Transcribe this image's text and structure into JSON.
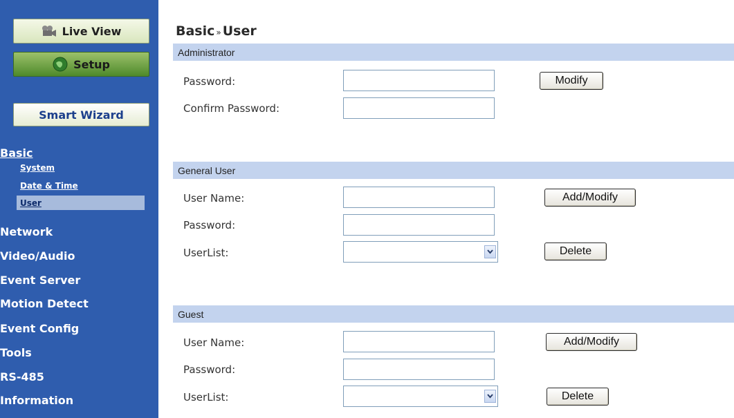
{
  "sidebar": {
    "live_view": "Live View",
    "setup": "Setup",
    "smart_wizard": "Smart Wizard",
    "menu": {
      "basic": "Basic",
      "submenu": [
        "System",
        "Date & Time",
        "User"
      ],
      "network": "Network",
      "video_audio": "Video/Audio",
      "event_server": "Event Server",
      "motion_detect": "Motion Detect",
      "event_config": "Event Config",
      "tools": "Tools",
      "rs485": "RS-485",
      "information": "Information"
    },
    "selected_submenu": "User"
  },
  "breadcrumb": {
    "section": "Basic",
    "separator": "»",
    "page": "User"
  },
  "administrator": {
    "heading": "Administrator",
    "password_label": "Password:",
    "confirm_label": "Confirm Password:",
    "password_value": "",
    "confirm_value": "",
    "modify_button": "Modify"
  },
  "general_user": {
    "heading": "General User",
    "username_label": "User Name:",
    "password_label": "Password:",
    "userlist_label": "UserList:",
    "username_value": "",
    "password_value": "",
    "userlist_selected": "",
    "add_modify_button": "Add/Modify",
    "delete_button": "Delete"
  },
  "guest": {
    "heading": "Guest",
    "username_label": "User Name:",
    "password_label": "Password:",
    "userlist_label": "UserList:",
    "username_value": "",
    "password_value": "",
    "userlist_selected": "",
    "add_modify_button": "Add/Modify",
    "delete_button": "Delete"
  },
  "colors": {
    "sidebar_bg": "#2f5dae",
    "section_bar": "#c3d3ee",
    "selected_item": "#a7bbdc"
  }
}
